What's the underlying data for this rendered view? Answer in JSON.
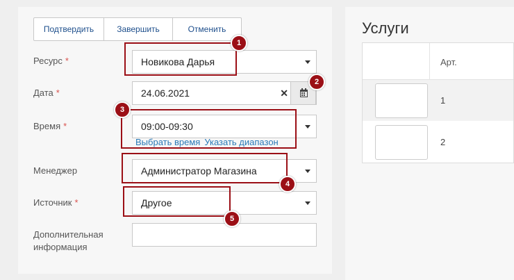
{
  "toolbar": {
    "confirm": "Подтвердить",
    "finish": "Завершить",
    "cancel": "Отменить"
  },
  "form": {
    "resource": {
      "label": "Ресурс",
      "required": "*",
      "value": "Новикова Дарья"
    },
    "date": {
      "label": "Дата",
      "required": "*",
      "value": "24.06.2021"
    },
    "time": {
      "label": "Время",
      "required": "*",
      "value": "09:00-09:30",
      "link_choose": "Выбрать время",
      "link_range": "Указать диапазон"
    },
    "manager": {
      "label": "Менеджер",
      "value": "Администратор Магазина"
    },
    "source": {
      "label": "Источник",
      "required": "*",
      "value": "Другое"
    },
    "extra": {
      "label_line1": "Дополнительная",
      "label_line2": "информация",
      "value": ""
    }
  },
  "markers": [
    "1",
    "2",
    "3",
    "4",
    "5"
  ],
  "services": {
    "title": "Услуги",
    "column_art": "Арт.",
    "rows": [
      "1",
      "2"
    ]
  },
  "colors": {
    "marker": "#9b0f16",
    "link": "#2a7ab8",
    "required": "#d9534f"
  }
}
